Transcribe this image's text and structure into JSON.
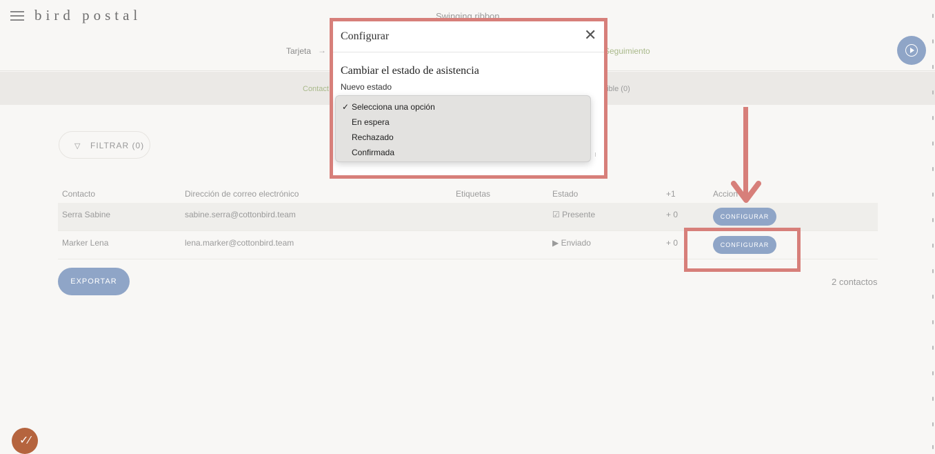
{
  "app": {
    "logo": "bird postal",
    "project_title": "Swinging ribbon",
    "menu_icon": "hamburger-menu-icon",
    "play_icon": "play-circle-icon"
  },
  "steps": {
    "tarjeta": "Tarjeta",
    "arrow": "→",
    "seguimiento": "Seguimiento"
  },
  "subnav": {
    "contacts_partial": "Contact",
    "available_partial": "nible (0)"
  },
  "filter": {
    "icon": "filter-funnel-icon",
    "label": "FILTRAR (0)"
  },
  "table": {
    "headers": {
      "contact": "Contacto",
      "email": "Dirección de correo electrónico",
      "tags": "Etiquetas",
      "state": "Estado",
      "plus": "+1",
      "actions": "Accion"
    },
    "rows": [
      {
        "contact": "Serra Sabine",
        "email": "sabine.serra@cottonbird.team",
        "state": "☑ Presente",
        "plus": "+ 0",
        "action": "CONFIGURAR"
      },
      {
        "contact": "Marker Lena",
        "email": "lena.marker@cottonbird.team",
        "state": "▶ Enviado",
        "plus": "+ 0",
        "action": "CONFIGURAR"
      }
    ]
  },
  "export_label": "EXPORTAR",
  "contacts_count": "2 contactos",
  "modal": {
    "title": "Configurar",
    "close_icon": "close-x-icon",
    "heading": "Cambiar el estado de asistencia",
    "field_label": "Nuevo estado",
    "options": [
      "Selecciona una opción",
      "En espera",
      "Rechazado",
      "Confirmada"
    ],
    "selected": "Selecciona una opción",
    "check": "✓"
  },
  "colors": {
    "accent_blue": "#8fa5c7",
    "accent_green": "#a9b98a",
    "annotation_red": "#d77f7a",
    "help_badge": "#b5643e"
  }
}
